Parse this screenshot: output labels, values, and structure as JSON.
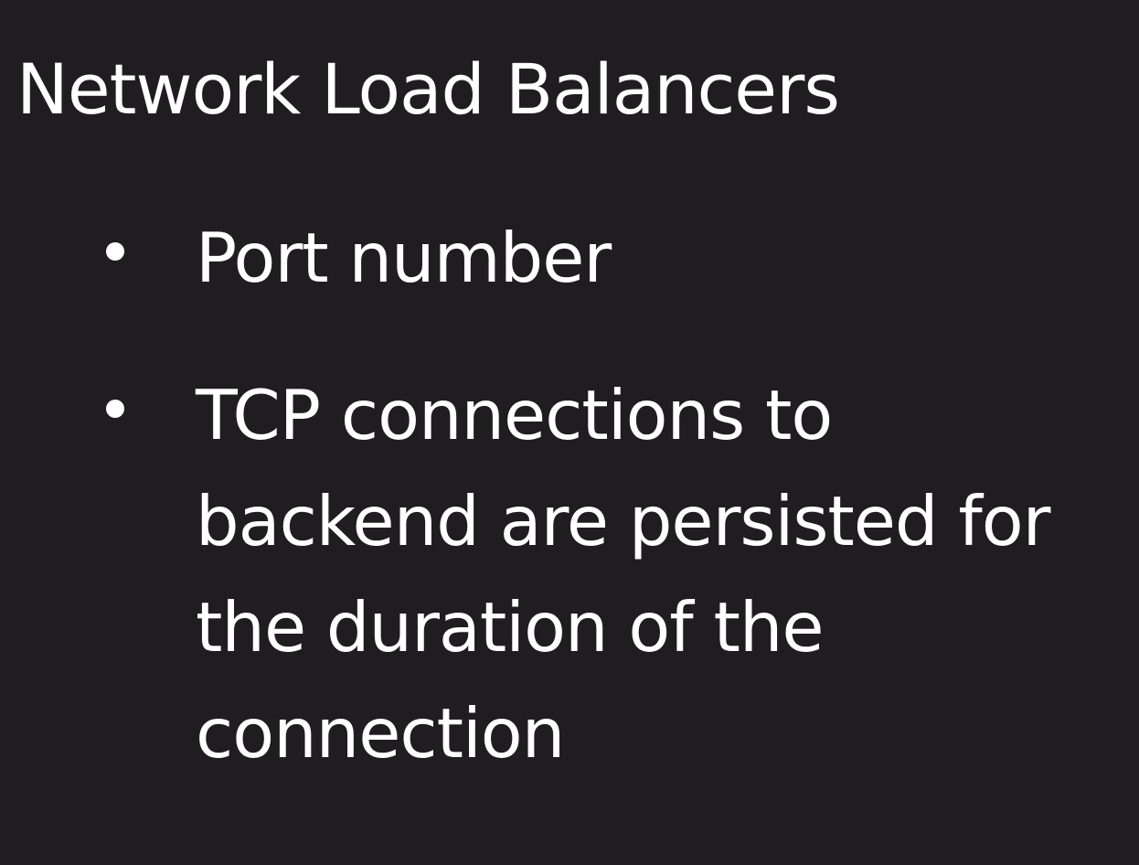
{
  "slide": {
    "title": "Network Load Balancers",
    "bullets": [
      {
        "text": "Port number"
      },
      {
        "text": "TCP connections to backend are persisted for the duration of the connection"
      }
    ]
  },
  "colors": {
    "background": "#1f1d1f",
    "text": "#ffffff"
  }
}
